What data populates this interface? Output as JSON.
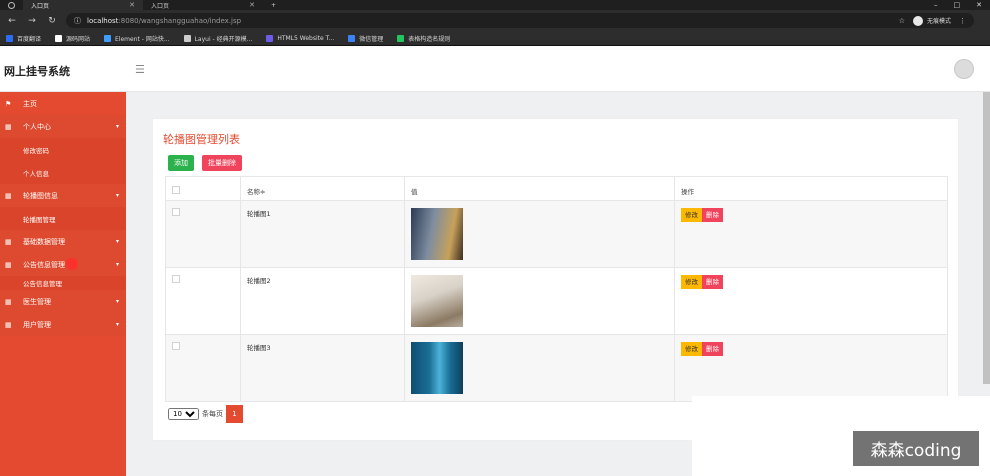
{
  "browser": {
    "tabs": [
      {
        "label": "入口页",
        "active": true
      },
      {
        "label": "入口页",
        "active": false
      }
    ],
    "new_tab": "+",
    "url_host": "localhost",
    "url_rest": ":8080/wangshangguahao/index.jsp",
    "incognito_label": "无痕模式",
    "bookmarks": [
      {
        "label": "百度翻译",
        "color": "#2d6df6"
      },
      {
        "label": "源码网站",
        "color": "#ffffff"
      },
      {
        "label": "Element - 网站快...",
        "color": "#409eff"
      },
      {
        "label": "Layui - 经典开源模...",
        "color": "#cccccc"
      },
      {
        "label": "HTML5 Website T...",
        "color": "#6c5ce7"
      },
      {
        "label": "微信管理",
        "color": "#3b82f6"
      },
      {
        "label": "表格构造名规则",
        "color": "#22c55e"
      }
    ]
  },
  "app": {
    "title": "网上挂号系统"
  },
  "sidebar": {
    "items": [
      {
        "label": "主页",
        "type": "top",
        "icon": "flag-icon"
      },
      {
        "label": "个人中心",
        "type": "parent",
        "icon": "grid-icon"
      },
      {
        "label": "修改密码",
        "type": "child"
      },
      {
        "label": "个人信息",
        "type": "child"
      },
      {
        "label": "轮播图信息",
        "type": "parent",
        "icon": "grid-icon"
      },
      {
        "label": "轮播图管理",
        "type": "child"
      },
      {
        "label": "基础数据管理",
        "type": "parent",
        "icon": "grid-icon"
      },
      {
        "label": "公告信息管理",
        "type": "parent",
        "icon": "grid-icon"
      },
      {
        "label": "公告信息管理",
        "type": "child"
      },
      {
        "label": "医生管理",
        "type": "parent",
        "icon": "grid-icon"
      },
      {
        "label": "用户管理",
        "type": "parent",
        "icon": "grid-icon"
      }
    ]
  },
  "main": {
    "title": "轮播图管理列表",
    "add_button": "添加",
    "batch_delete_button": "批量删除",
    "columns": [
      "名称≑",
      "值",
      "操作"
    ],
    "rows": [
      {
        "name": "轮播图1",
        "thumb_colors": [
          "#2a3b55",
          "#c7a15a"
        ]
      },
      {
        "name": "轮播图2",
        "thumb_colors": [
          "#d8d2c8",
          "#8c7a63"
        ]
      },
      {
        "name": "轮播图3",
        "thumb_colors": [
          "#1a6e96",
          "#4bb3d8"
        ]
      }
    ],
    "edit_label": "修改",
    "delete_label": "删除",
    "page_size": "10",
    "page_size_suffix": "条每页",
    "current_page": "1"
  },
  "watermark": "森森coding",
  "colors": {
    "sidebar": "#e34a2f",
    "accent": "#e34a2f",
    "add": "#2bb24c",
    "delete": "#f0445c",
    "edit": "#ffb800"
  }
}
